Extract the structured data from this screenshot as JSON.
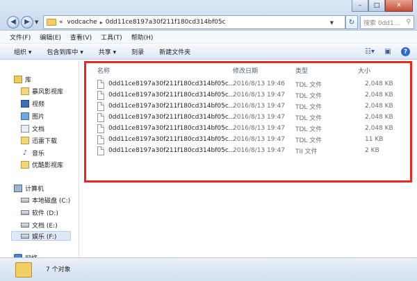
{
  "window": {
    "minimize_label": "–",
    "maximize_label": "□",
    "close_label": "✕"
  },
  "address": {
    "prefix": "«",
    "crumb1": "vodcache",
    "separator": "▸",
    "crumb2": "0dd11ce8197a30f211f180cd314bf05c",
    "search_placeholder": "搜索 0dd1..."
  },
  "menu": [
    "文件(F)",
    "编辑(E)",
    "查看(V)",
    "工具(T)",
    "帮助(H)"
  ],
  "toolbar": {
    "organize": "组织 ▾",
    "include": "包含到库中 ▾",
    "share": "共享 ▾",
    "burn": "刻录",
    "new_folder": "新建文件夹"
  },
  "sidebar": {
    "library": "库",
    "items": [
      "暴风影视库",
      "视频",
      "图片",
      "文档",
      "迅雷下载",
      "音乐",
      "优酷影视库"
    ],
    "computer": "计算机",
    "drives": [
      "本地磁盘 (C:)",
      "软件 (D:)",
      "文档 (E:)",
      "娱乐 (F:)"
    ],
    "network": "网络"
  },
  "columns": {
    "name": "名称",
    "date": "修改日期",
    "type": "类型",
    "size": "大小"
  },
  "files": [
    {
      "name": "0dd11ce8197a30f211f180cd314bf05c...",
      "date": "2016/8/13 19:46",
      "type": "TDL 文件",
      "size": "2,048 KB"
    },
    {
      "name": "0dd11ce8197a30f211f180cd314bf05c...",
      "date": "2016/8/13 19:47",
      "type": "TDL 文件",
      "size": "2,048 KB"
    },
    {
      "name": "0dd11ce8197a30f211f180cd314bf05c...",
      "date": "2016/8/13 19:47",
      "type": "TDL 文件",
      "size": "2,048 KB"
    },
    {
      "name": "0dd11ce8197a30f211f180cd314bf05c...",
      "date": "2016/8/13 19:47",
      "type": "TDL 文件",
      "size": "2,048 KB"
    },
    {
      "name": "0dd11ce8197a30f211f180cd314bf05c...",
      "date": "2016/8/13 19:47",
      "type": "TDL 文件",
      "size": "2,048 KB"
    },
    {
      "name": "0dd11ce8197a30f211f180cd314bf05c...",
      "date": "2016/8/13 19:47",
      "type": "TDL 文件",
      "size": "11 KB"
    },
    {
      "name": "0dd11ce8197a30f211f180cd314bf05c...",
      "date": "2016/8/13 19:47",
      "type": "TII 文件",
      "size": "2 KB"
    }
  ],
  "status": {
    "count": "7 个对象"
  },
  "colors": {
    "highlight": "#e8271f",
    "accent": "#2f6bc5"
  }
}
